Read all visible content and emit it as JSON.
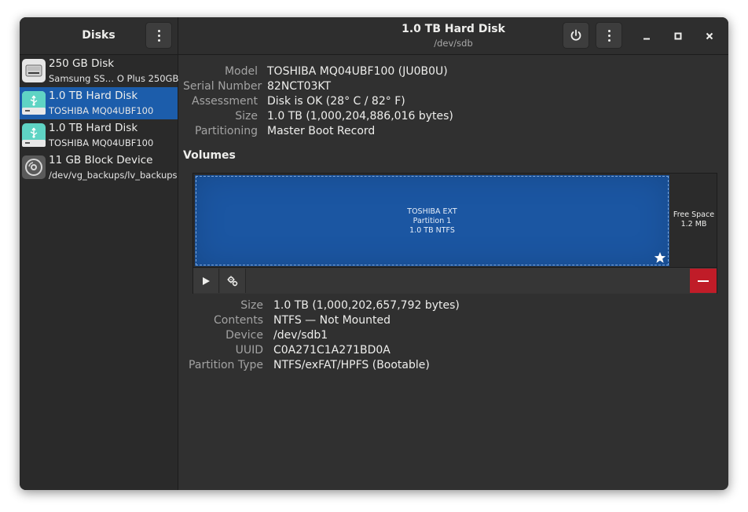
{
  "sidebar": {
    "title": "Disks",
    "disks": [
      {
        "name": "250 GB Disk",
        "sub": "Samsung SS… O Plus 250GB",
        "icon": "ssd-icon",
        "selected": false
      },
      {
        "name": "1.0 TB Hard Disk",
        "sub": "TOSHIBA MQ04UBF100",
        "icon": "usb-drive-icon",
        "selected": true
      },
      {
        "name": "1.0 TB Hard Disk",
        "sub": "TOSHIBA MQ04UBF100",
        "icon": "usb-drive-icon",
        "selected": false
      },
      {
        "name": "11 GB Block Device",
        "sub": "/dev/vg_backups/lv_backups",
        "icon": "block-device-icon",
        "selected": false
      }
    ]
  },
  "header": {
    "title": "1.0 TB Hard Disk",
    "subtitle": "/dev/sdb"
  },
  "drive_info": [
    {
      "label": "Model",
      "value": "TOSHIBA MQ04UBF100 (JU0B0U)"
    },
    {
      "label": "Serial Number",
      "value": "82NCT03KT"
    },
    {
      "label": "Assessment",
      "value": "Disk is OK (28° C / 82° F)"
    },
    {
      "label": "Size",
      "value": "1.0 TB (1,000,204,886,016 bytes)"
    },
    {
      "label": "Partitioning",
      "value": "Master Boot Record"
    }
  ],
  "volumes": {
    "title": "Volumes",
    "partition": {
      "line1": "TOSHIBA EXT",
      "line2": "Partition 1",
      "line3": "1.0 TB NTFS"
    },
    "free_space": {
      "line1": "Free Space",
      "line2": "1.2 MB"
    }
  },
  "volume_info": [
    {
      "label": "Size",
      "value": "1.0 TB (1,000,202,657,792 bytes)"
    },
    {
      "label": "Contents",
      "value": "NTFS — Not Mounted"
    },
    {
      "label": "Device",
      "value": "/dev/sdb1"
    },
    {
      "label": "UUID",
      "value": "C0A271C1A271BD0A"
    },
    {
      "label": "Partition Type",
      "value": "NTFS/exFAT/HPFS (Bootable)"
    }
  ],
  "colors": {
    "accent": "#1c5dab",
    "partition": "#1b56a2",
    "destructive": "#c01c28",
    "usb_icon": "#5fd4c4"
  }
}
